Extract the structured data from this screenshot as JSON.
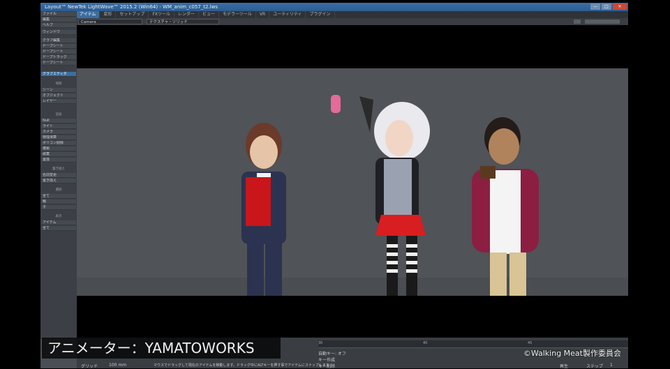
{
  "window": {
    "title": "Layout™ NewTek LightWave™ 2015.2 (Win64) - WM_anim_c057_t2.lws",
    "controls": [
      "—",
      "□",
      "✕"
    ]
  },
  "menu_tabs": [
    {
      "label": "アイテム",
      "active": true
    },
    {
      "label": "変形",
      "active": false
    },
    {
      "label": "セットアップ",
      "active": false
    },
    {
      "label": "FXツール",
      "active": false
    },
    {
      "label": "レンダー",
      "active": false
    },
    {
      "label": "ビュー",
      "active": false
    },
    {
      "label": "モデラーツール",
      "active": false
    },
    {
      "label": "VR",
      "active": false
    },
    {
      "label": "ユーティリティ",
      "active": false
    },
    {
      "label": "プラグイン",
      "active": false
    }
  ],
  "toolbar2": {
    "camera": "Camera",
    "shading": "テクスチャ・ソリッド"
  },
  "sidebar": {
    "items": [
      "ファイル",
      "編集",
      "ヘルプ",
      "ウィンドウ",
      "",
      "グラフ編集",
      "ドープシート",
      "ドープシート",
      "ドープトラック",
      "",
      "ドープシート",
      "",
      "グラフエディタ",
      "シーン",
      "",
      "シーン",
      "オブジェクト",
      "レイヤー",
      "追加",
      "Null",
      "ライト",
      "カメラ",
      "物理演算",
      "ポリゴン削除",
      "複製",
      "破棄",
      "置換",
      "置き換え",
      "名前変更",
      "置き換え",
      "選択",
      "全て",
      "親",
      "子",
      "表示",
      "アイテム",
      "全て"
    ],
    "headers": [
      "項目",
      "追加",
      "置き換え",
      "選択",
      "表示"
    ]
  },
  "timeline": {
    "ticks": [
      "30",
      "40",
      "45"
    ],
    "fields": [
      "グリッド",
      "100 mm",
      "自動キー: オフ",
      "キー作成",
      "キー削除",
      "再生",
      "ステップ",
      "1"
    ],
    "status": "マウスでドラッグして現在のアイテムを移動します。ドラッグ中にALTキーを押す事でアイテムにスナップします"
  },
  "overlay": {
    "caption": "アニメーター：YAMATOWORKS",
    "copyright": "©Walking Meat製作委員会"
  }
}
